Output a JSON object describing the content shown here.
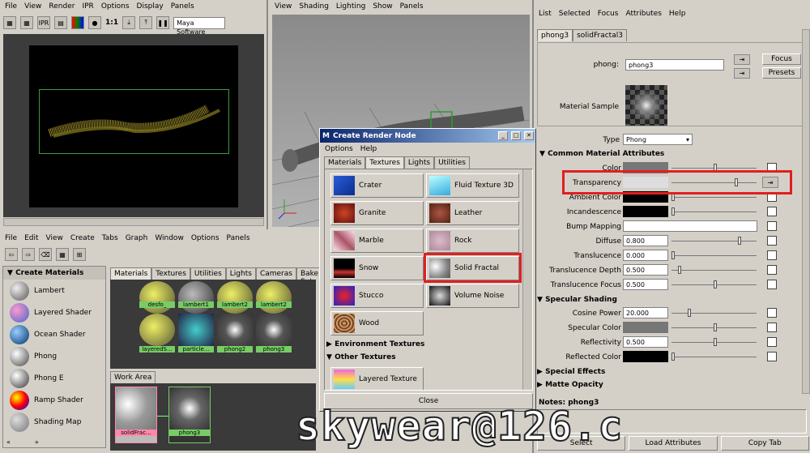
{
  "render_view": {
    "menu": [
      "File",
      "View",
      "Render",
      "IPR",
      "Options",
      "Display",
      "Panels"
    ],
    "renderer": "Maya Software",
    "ratio": "1:1"
  },
  "viewport": {
    "menu": [
      "View",
      "Shading",
      "Lighting",
      "Show",
      "Panels"
    ]
  },
  "attr_editor": {
    "menu": [
      "List",
      "Selected",
      "Focus",
      "Attributes",
      "Help"
    ],
    "tabs": [
      "phong3",
      "solidFractal3"
    ],
    "name_label": "phong:",
    "name_value": "phong3",
    "focus": "Focus",
    "presets": "Presets",
    "sample_label": "Material Sample",
    "type_label": "Type",
    "type_value": "Phong",
    "section_common": "Common Material Attributes",
    "rows": [
      {
        "label": "Color",
        "value": ""
      },
      {
        "label": "Transparency",
        "value": ""
      },
      {
        "label": "Ambient Color",
        "value": ""
      },
      {
        "label": "Incandescence",
        "value": ""
      },
      {
        "label": "Bump Mapping",
        "value": ""
      },
      {
        "label": "Diffuse",
        "value": "0.800"
      },
      {
        "label": "Translucence",
        "value": "0.000"
      },
      {
        "label": "Translucence Depth",
        "value": "0.500"
      },
      {
        "label": "Translucence Focus",
        "value": "0.500"
      }
    ],
    "section_spec": "Specular Shading",
    "spec_rows": [
      {
        "label": "Cosine Power",
        "value": "20.000"
      },
      {
        "label": "Specular Color",
        "value": ""
      },
      {
        "label": "Reflectivity",
        "value": "0.500"
      },
      {
        "label": "Reflected Color",
        "value": ""
      }
    ],
    "section_fx": "Special Effects",
    "section_matte": "Matte Opacity",
    "notes": "Notes: phong3",
    "bottom": [
      "Select",
      "Load Attributes",
      "Copy Tab"
    ]
  },
  "hypershade": {
    "menu": [
      "File",
      "Edit",
      "View",
      "Create",
      "Tabs",
      "Graph",
      "Window",
      "Options",
      "Panels"
    ],
    "create_title": "Create Materials",
    "materials": [
      "Lambert",
      "Layered Shader",
      "Ocean Shader",
      "Phong",
      "Phong E",
      "Ramp Shader",
      "Shading Map"
    ],
    "tabs": [
      "Materials",
      "Textures",
      "Utilities",
      "Lights",
      "Cameras",
      "Bake Sets"
    ],
    "swatches_row1": [
      "desfo_",
      "lambert1",
      "lambert2",
      "lambert2"
    ],
    "swatches_row2": [
      "layeredS...",
      "particle...",
      "phong2",
      "phong3"
    ],
    "work_tab": "Work Area",
    "node1": "solidFrac...",
    "node2": "phong3"
  },
  "dialog": {
    "title": "Create Render Node",
    "menu": [
      "Options",
      "Help"
    ],
    "tabs": [
      "Materials",
      "Textures",
      "Lights",
      "Utilities"
    ],
    "textures": [
      "Crater",
      "Fluid Texture 3D",
      "Granite",
      "Leather",
      "Marble",
      "Rock",
      "Snow",
      "Solid Fractal",
      "Stucco",
      "Volume Noise",
      "Wood"
    ],
    "env": "Environment Textures",
    "other": "Other Textures",
    "layered": "Layered Texture",
    "close": "Close"
  },
  "watermark": "skywear@126.c"
}
